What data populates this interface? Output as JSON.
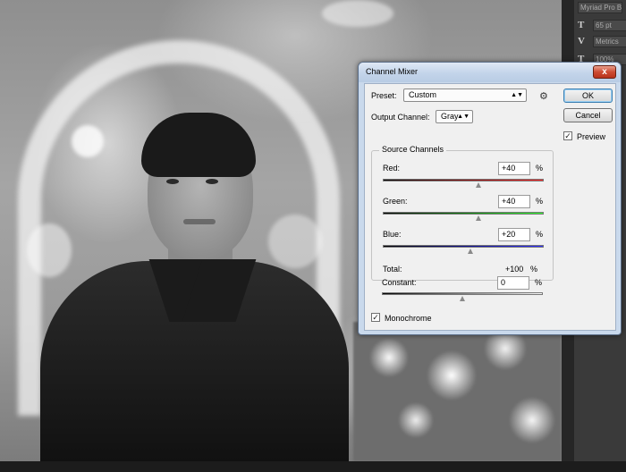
{
  "dialog": {
    "title": "Channel Mixer",
    "close_glyph": "x",
    "preset_label": "Preset:",
    "preset_value": "Custom",
    "output_channel_label": "Output Channel:",
    "output_channel_value": "Gray",
    "ok_label": "OK",
    "cancel_label": "Cancel",
    "preview_label": "Preview",
    "preview_checked": true,
    "source_channels_title": "Source Channels",
    "channels": [
      {
        "label": "Red:",
        "value": "+40",
        "unit": "%",
        "slider_fraction": 0.6,
        "color": "#d11c1c"
      },
      {
        "label": "Green:",
        "value": "+40",
        "unit": "%",
        "slider_fraction": 0.6,
        "color": "#1fbf1f"
      },
      {
        "label": "Blue:",
        "value": "+20",
        "unit": "%",
        "slider_fraction": 0.55,
        "color": "#1a23c8"
      }
    ],
    "total_label": "Total:",
    "total_value": "+100",
    "total_unit": "%",
    "constant_label": "Constant:",
    "constant_value": "0",
    "constant_unit": "%",
    "constant_slider_fraction": 0.5,
    "monochrome_label": "Monochrome",
    "monochrome_checked": true
  },
  "side_panel": {
    "font_family_value": "Myriad Pro Bo",
    "font_size_value": "65 pt",
    "kerning_value": "Metrics",
    "scale_value": "100%"
  }
}
